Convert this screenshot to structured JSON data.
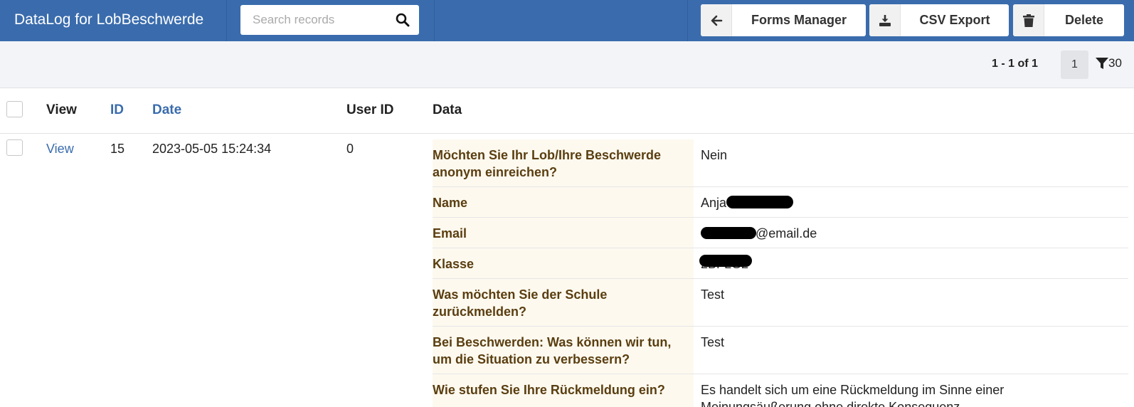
{
  "header": {
    "title": "DataLog for LobBeschwerde",
    "search_placeholder": "Search records",
    "buttons": {
      "forms_manager": "Forms Manager",
      "csv_export": "CSV Export",
      "delete": "Delete"
    }
  },
  "pagination": {
    "range": "1 - 1 of 1",
    "current_page": "1",
    "per_page": "30"
  },
  "table": {
    "columns": {
      "view": "View",
      "id": "ID",
      "date": "Date",
      "user_id": "User ID",
      "data": "Data"
    },
    "row": {
      "view_link": "View",
      "id": "15",
      "date": "2023-05-05 15:24:34",
      "user_id": "0",
      "fields": [
        {
          "key": "Möchten Sie Ihr Lob/Ihre Beschwerde anonym einreichen?",
          "value": "Nein"
        },
        {
          "key": "Name",
          "value": "Anja"
        },
        {
          "key": "Email",
          "value": "@email.de"
        },
        {
          "key": "Klasse",
          "value": "2BFLG2"
        },
        {
          "key": "Was möchten Sie der Schule zurückmelden?",
          "value": "Test"
        },
        {
          "key": "Bei Beschwerden: Was können wir tun, um die Situation zu verbessern?",
          "value": "Test"
        },
        {
          "key": "Wie stufen Sie Ihre Rückmeldung ein?",
          "value": "Es handelt sich um eine Rückmeldung im Sinne einer Meinungsäußerung ohne direkte Konsequenz."
        }
      ]
    }
  },
  "colors": {
    "header_bg": "#3a6cad",
    "link": "#3a6cad",
    "data_key_bg": "#fdf9ef",
    "data_key_text": "#5a3e10"
  },
  "icons": {
    "search": "search-icon",
    "back": "arrow-left-icon",
    "export": "download-icon",
    "delete": "trash-icon",
    "filter": "filter-icon"
  }
}
